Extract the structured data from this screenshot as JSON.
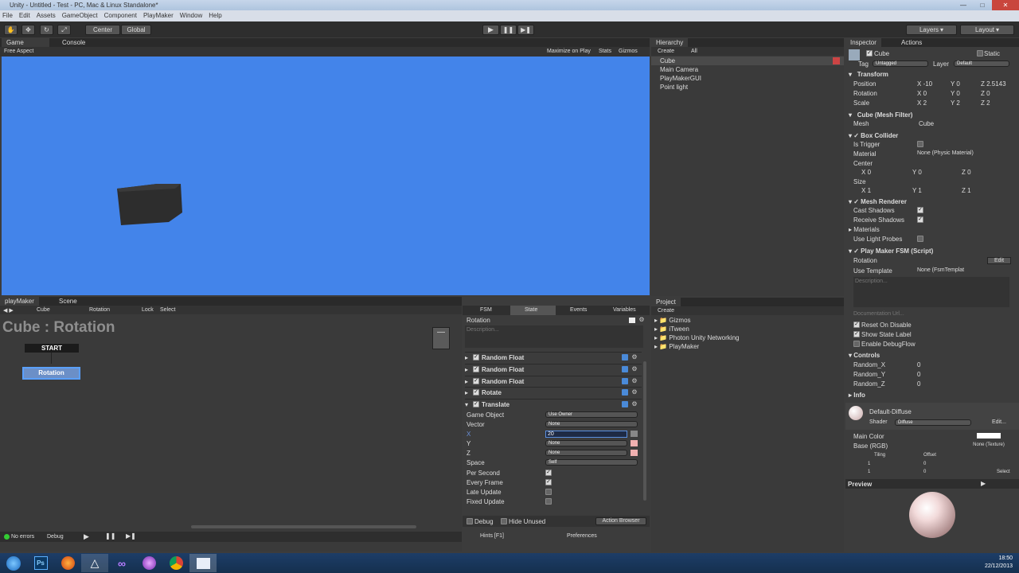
{
  "window": {
    "title": "Unity - Untitled - Test - PC, Mac & Linux Standalone*"
  },
  "menu": [
    "File",
    "Edit",
    "Assets",
    "GameObject",
    "Component",
    "PlayMaker",
    "Window",
    "Help"
  ],
  "toolbar": {
    "center": "Center",
    "global": "Global",
    "layers": "Layers",
    "layout": "Layout"
  },
  "game": {
    "tab_game": "Game",
    "tab_console": "Console",
    "aspect": "Free Aspect",
    "maximize": "Maximize on Play",
    "stats": "Stats",
    "gizmos": "Gizmos",
    "bg": "#4384ea"
  },
  "hierarchy": {
    "tab": "Hierarchy",
    "create": "Create",
    "search": "All",
    "items": [
      "Cube",
      "Main Camera",
      "PlayMakerGUI",
      "Point light"
    ]
  },
  "project": {
    "tab": "Project",
    "create": "Create",
    "items": [
      "Gizmos",
      "iTween",
      "Photon Unity Networking",
      "PlayMaker"
    ]
  },
  "playmaker": {
    "tab": "playMaker",
    "scene_tab": "Scene",
    "obj": "Cube",
    "fsm": "Rotation",
    "lock": "Lock",
    "select": "Select",
    "heading": "Cube : Rotation",
    "start": "START",
    "state": "Rotation",
    "status": "No errors",
    "debug": "Debug"
  },
  "state_panel": {
    "tabs": [
      "FSM",
      "State",
      "Events",
      "Variables"
    ],
    "name": "Rotation",
    "desc": "Description...",
    "actions": [
      "Random Float",
      "Random Float",
      "Random Float",
      "Rotate",
      "Translate"
    ],
    "fields": [
      {
        "label": "Game Object",
        "value": "Use Owner"
      },
      {
        "label": "Vector",
        "value": "None"
      },
      {
        "label": "X",
        "value": "20"
      },
      {
        "label": "Y",
        "value": "None"
      },
      {
        "label": "Z",
        "value": "None"
      },
      {
        "label": "Space",
        "value": "Self"
      }
    ],
    "checks": [
      {
        "label": "Per Second",
        "on": true
      },
      {
        "label": "Every Frame",
        "on": true
      },
      {
        "label": "Late Update",
        "on": false
      },
      {
        "label": "Fixed Update",
        "on": false
      }
    ],
    "debug": "Debug",
    "hide_unused": "Hide Unused",
    "action_browser": "Action Browser",
    "hints": "Hints [F1]",
    "prefs": "Preferences"
  },
  "inspector": {
    "tab": "Inspector",
    "tab2": "Actions",
    "name": "Cube",
    "static": "Static",
    "tag_label": "Tag",
    "tag": "Untagged",
    "layer_label": "Layer",
    "layer": "Default",
    "transform": "Transform",
    "position": {
      "label": "Position",
      "x": "-10",
      "y": "0",
      "z": "2.5143"
    },
    "rotation": {
      "label": "Rotation",
      "x": "0",
      "y": "0",
      "z": "0"
    },
    "scale": {
      "label": "Scale",
      "x": "2",
      "y": "2",
      "z": "2"
    },
    "meshfilter": "Cube (Mesh Filter)",
    "mesh_label": "Mesh",
    "mesh": "Cube",
    "collider": "Box Collider",
    "is_trigger": "Is Trigger",
    "material_label": "Material",
    "material": "None (Physic Material)",
    "center": "Center",
    "center_vals": {
      "x": "0",
      "y": "0",
      "z": "0"
    },
    "size": "Size",
    "size_vals": {
      "x": "1",
      "y": "1",
      "z": "1"
    },
    "renderer": "Mesh Renderer",
    "cast": "Cast Shadows",
    "receive": "Receive Shadows",
    "materials": "Materials",
    "probes": "Use Light Probes",
    "fsm": "Play Maker FSM (Script)",
    "fsm_name": "Rotation",
    "edit": "Edit",
    "template_label": "Use Template",
    "template": "None (FsmTemplat",
    "desc": "Description...",
    "doc": "Documentation Url...",
    "reset": "Reset On Disable",
    "show_label": "Show State Label",
    "debugflow": "Enable DebugFlow",
    "controls": "Controls",
    "rx": "Random_X",
    "ry": "Random_Y",
    "rz": "Random_Z",
    "rval": "0",
    "info": "Info",
    "mat_name": "Default-Diffuse",
    "shader_label": "Shader",
    "shader": "Diffuse",
    "edit2": "Edit...",
    "main_color": "Main Color",
    "base": "Base (RGB)",
    "tiling": "Tiling",
    "offset": "Offset",
    "tx": "1",
    "ty": "1",
    "ox": "0",
    "oy": "0",
    "none_tex": "None (Texture)",
    "select": "Select",
    "preview": "Preview"
  },
  "clock": {
    "time": "18:50",
    "date": "22/12/2013"
  }
}
